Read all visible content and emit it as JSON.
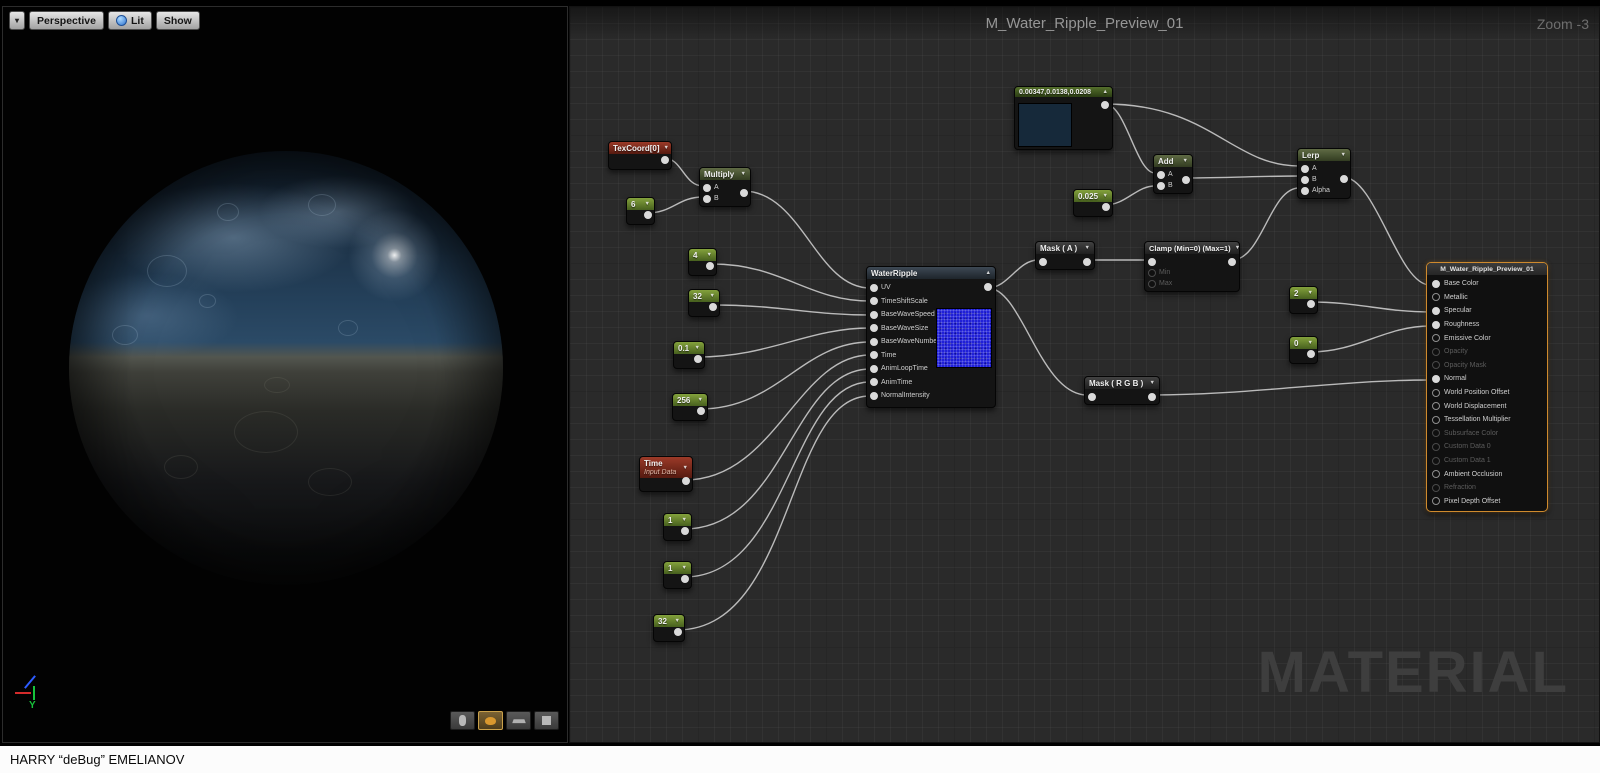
{
  "credit_bar": {
    "text": "HARRY “deBug” EMELIANOV"
  },
  "viewport": {
    "toolbar": {
      "dropdown_glyph": "▾",
      "perspective_label": "Perspective",
      "lit_label": "Lit",
      "show_label": "Show"
    },
    "axis_y_label": "Y"
  },
  "graph": {
    "title": "M_Water_Ripple_Preview_01",
    "zoom_label": "Zoom -3",
    "watermark": "MATERIAL",
    "glyphs": {
      "collapsed": "▼",
      "expanded": "▲"
    },
    "nodes": {
      "texcoord": {
        "title": "TexCoord[0]"
      },
      "multiply": {
        "title": "Multiply",
        "pin_a": "A",
        "pin_b": "B"
      },
      "const_6": {
        "value": "6"
      },
      "const_4": {
        "value": "4"
      },
      "const_32_speed": {
        "value": "32"
      },
      "const_0_1": {
        "value": "0.1"
      },
      "const_256": {
        "value": "256"
      },
      "time": {
        "title": "Time",
        "subtitle": "Input Data"
      },
      "const_1_loop": {
        "value": "1"
      },
      "const_1_anim": {
        "value": "1"
      },
      "const_32_normal": {
        "value": "32"
      },
      "water_ripple": {
        "title": "WaterRipple",
        "inputs": [
          "UV",
          "TimeShiftScale",
          "BaseWaveSpeed",
          "BaseWaveSize",
          "BaseWaveNumber",
          "Time",
          "AnimLoopTime",
          "AnimTime",
          "NormalIntensity"
        ]
      },
      "color_const": {
        "title": "0.00347,0.0138,0.0208"
      },
      "const_0_025": {
        "value": "0.025"
      },
      "add": {
        "title": "Add",
        "pin_a": "A",
        "pin_b": "B"
      },
      "mask_a": {
        "title": "Mask ( A )"
      },
      "clamp": {
        "title": "Clamp (Min=0) (Max=1)",
        "pin_min": "Min",
        "pin_max": "Max"
      },
      "lerp": {
        "title": "Lerp",
        "pin_a": "A",
        "pin_b": "B",
        "pin_alpha": "Alpha"
      },
      "const_2": {
        "value": "2"
      },
      "const_0": {
        "value": "0"
      },
      "mask_rgb": {
        "title": "Mask ( R G B )"
      },
      "material": {
        "title": "M_Water_Ripple_Preview_01",
        "pins": [
          {
            "label": "Base Color"
          },
          {
            "label": "Metallic"
          },
          {
            "label": "Specular"
          },
          {
            "label": "Roughness"
          },
          {
            "label": "Emissive Color"
          },
          {
            "label": "Opacity"
          },
          {
            "label": "Opacity Mask"
          },
          {
            "label": "Normal"
          },
          {
            "label": "World Position Offset"
          },
          {
            "label": "World Displacement"
          },
          {
            "label": "Tessellation Multiplier"
          },
          {
            "label": "Subsurface Color"
          },
          {
            "label": "Custom Data 0"
          },
          {
            "label": "Custom Data 1"
          },
          {
            "label": "Ambient Occlusion"
          },
          {
            "label": "Refraction"
          },
          {
            "label": "Pixel Depth Offset"
          }
        ]
      }
    }
  }
}
